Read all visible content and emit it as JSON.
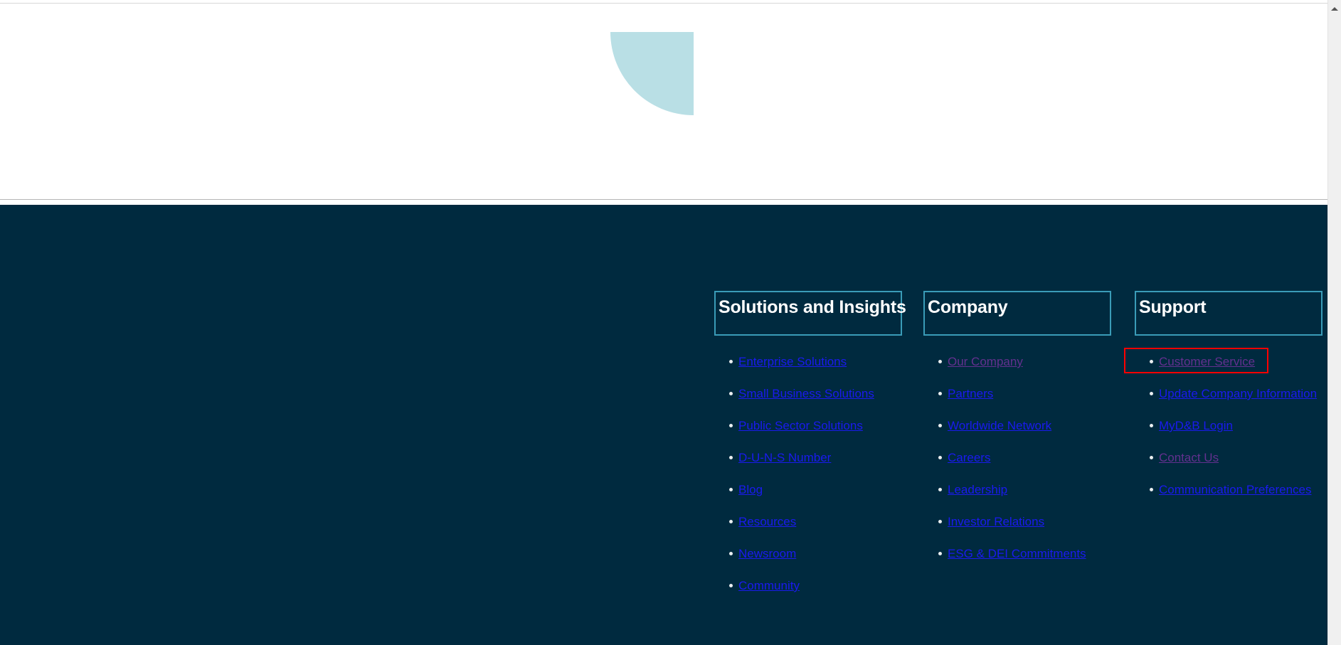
{
  "page": {
    "background": "#ffffff",
    "footer_background": "#002a3f"
  },
  "decoration": {
    "quarter_circle_color": "#b9dfe5",
    "quarter_circle_name": "quarter-circle-decoration"
  },
  "colors": {
    "heading_border": "#3a9cb8",
    "link": "#1a1aee",
    "link_visited": "#63308f",
    "highlight": "#ff0000",
    "bullet": "#e9eef0",
    "divider": "#b5b5b5"
  },
  "footer": {
    "columns": [
      {
        "heading": "Solutions and Insights",
        "links": [
          {
            "label": "Enterprise Solutions",
            "visited": false
          },
          {
            "label": "Small Business Solutions",
            "visited": false
          },
          {
            "label": "Public Sector Solutions",
            "visited": false
          },
          {
            "label": "D-U-N-S Number",
            "visited": false
          },
          {
            "label": "Blog",
            "visited": false
          },
          {
            "label": "Resources",
            "visited": false
          },
          {
            "label": "Newsroom",
            "visited": false
          },
          {
            "label": "Community",
            "visited": false
          }
        ]
      },
      {
        "heading": "Company",
        "links": [
          {
            "label": "Our Company",
            "visited": true
          },
          {
            "label": "Partners",
            "visited": false
          },
          {
            "label": "Worldwide Network",
            "visited": false
          },
          {
            "label": "Careers",
            "visited": false
          },
          {
            "label": "Leadership",
            "visited": false
          },
          {
            "label": "Investor Relations",
            "visited": false
          },
          {
            "label": "ESG & DEI Commitments",
            "visited": false
          }
        ]
      },
      {
        "heading": "Support",
        "links": [
          {
            "label": "Customer Service",
            "visited": true
          },
          {
            "label": "Update Company Information",
            "visited": false
          },
          {
            "label": "MyD&B Login",
            "visited": false
          },
          {
            "label": "Contact Us",
            "visited": true
          },
          {
            "label": "Communication Preferences",
            "visited": false
          }
        ]
      }
    ]
  },
  "highlight": {
    "target_label": "Customer Service"
  },
  "scrollbar": {
    "up_arrow": "scroll-up-arrow"
  }
}
